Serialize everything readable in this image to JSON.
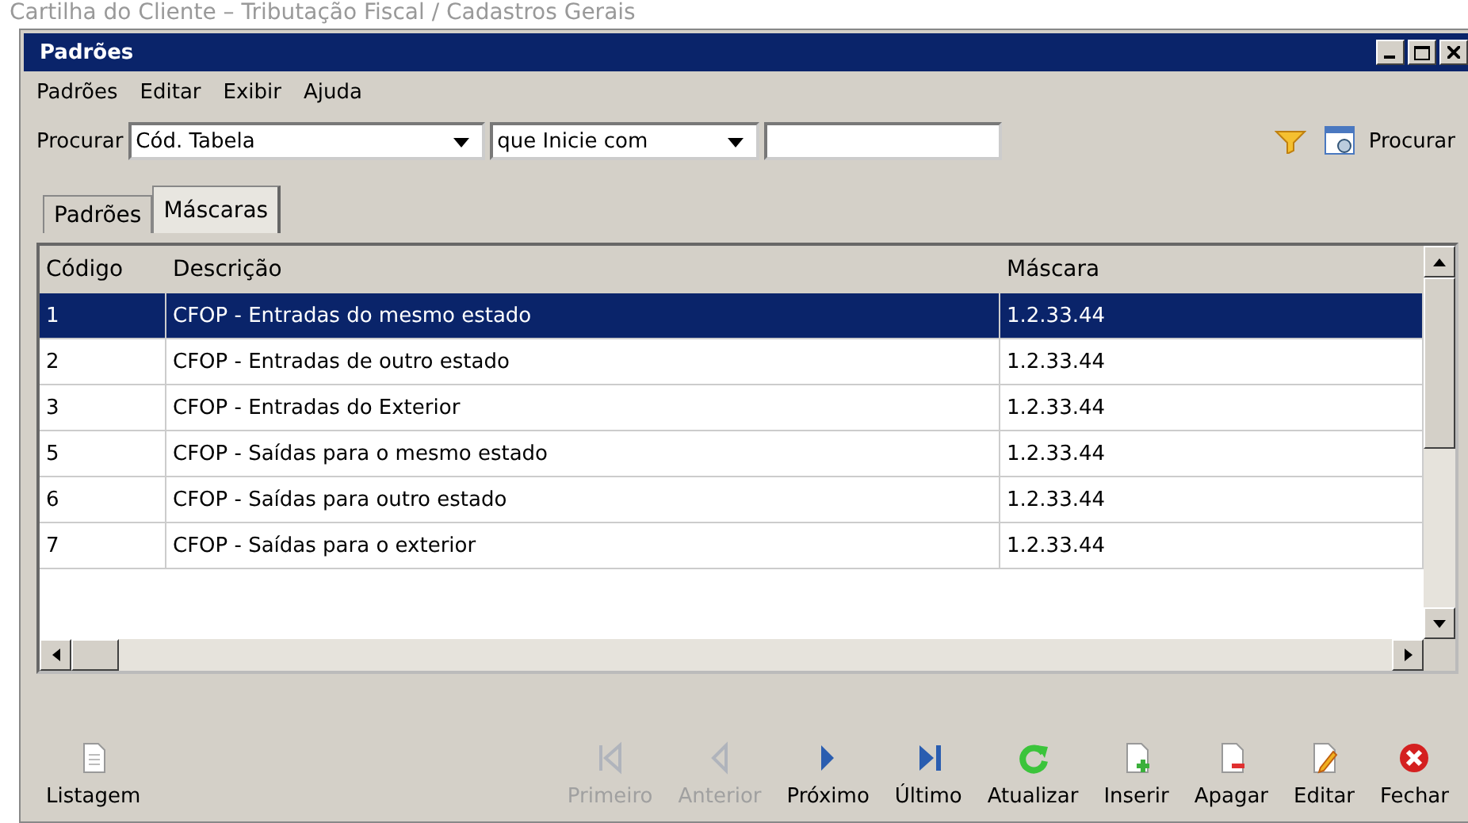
{
  "page_heading": "Cartilha do Cliente – Tributação Fiscal / Cadastros Gerais",
  "window": {
    "title": "Padrões"
  },
  "menu": [
    "Padrões",
    "Editar",
    "Exibir",
    "Ajuda"
  ],
  "search": {
    "label": "Procurar",
    "field": "Cód. Tabela",
    "condition": "que Inicie com",
    "button": "Procurar"
  },
  "tabs": [
    {
      "label": "Padrões",
      "selected": false
    },
    {
      "label": "Máscaras",
      "selected": true
    }
  ],
  "table": {
    "columns": [
      "Código",
      "Descrição",
      "Máscara"
    ],
    "rows": [
      {
        "cells": [
          "1",
          "CFOP - Entradas do mesmo estado",
          "1.2.33.44"
        ],
        "selected": true
      },
      {
        "cells": [
          "2",
          "CFOP - Entradas de outro estado",
          "1.2.33.44"
        ],
        "selected": false
      },
      {
        "cells": [
          "3",
          "CFOP - Entradas do Exterior",
          "1.2.33.44"
        ],
        "selected": false
      },
      {
        "cells": [
          "5",
          "CFOP - Saídas para o mesmo estado",
          "1.2.33.44"
        ],
        "selected": false
      },
      {
        "cells": [
          "6",
          "CFOP - Saídas para outro estado",
          "1.2.33.44"
        ],
        "selected": false
      },
      {
        "cells": [
          "7",
          "CFOP - Saídas para o exterior",
          "1.2.33.44"
        ],
        "selected": false
      }
    ]
  },
  "toolbar": [
    {
      "label": "Listagem",
      "kind": "list",
      "disabled": false
    },
    {
      "label": "Primeiro",
      "kind": "first",
      "disabled": true
    },
    {
      "label": "Anterior",
      "kind": "prev",
      "disabled": true
    },
    {
      "label": "Próximo",
      "kind": "next",
      "disabled": false
    },
    {
      "label": "Último",
      "kind": "last",
      "disabled": false
    },
    {
      "label": "Atualizar",
      "kind": "refresh",
      "disabled": false
    },
    {
      "label": "Inserir",
      "kind": "insert",
      "disabled": false
    },
    {
      "label": "Apagar",
      "kind": "delete",
      "disabled": false
    },
    {
      "label": "Editar",
      "kind": "edit",
      "disabled": false
    },
    {
      "label": "Fechar",
      "kind": "close",
      "disabled": false
    }
  ]
}
